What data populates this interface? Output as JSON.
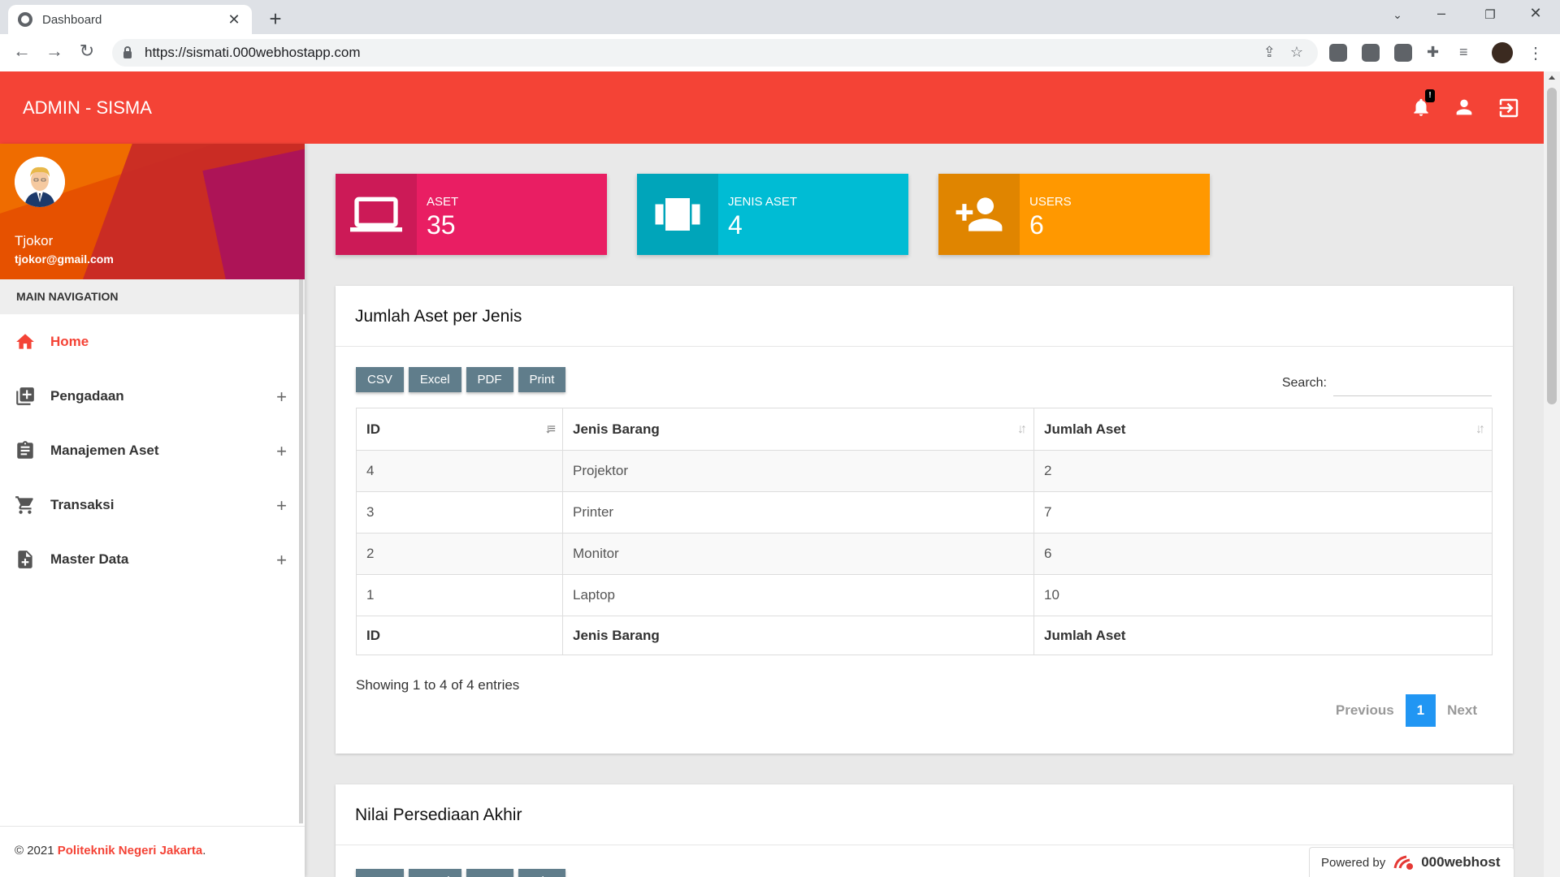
{
  "browser": {
    "tab_title": "Dashboard",
    "url": "https://sismati.000webhostapp.com"
  },
  "header": {
    "brand": "ADMIN - SISMA",
    "notification_count": "!"
  },
  "sidebar": {
    "user_name": "Tjokor",
    "user_email": "tjokor@gmail.com",
    "menu_header": "MAIN NAVIGATION",
    "items": [
      {
        "label": "Home",
        "icon": "home-icon",
        "active": true
      },
      {
        "label": "Pengadaan",
        "icon": "library-add-icon"
      },
      {
        "label": "Manajemen Aset",
        "icon": "assignment-icon"
      },
      {
        "label": "Transaksi",
        "icon": "cart-icon"
      },
      {
        "label": "Master Data",
        "icon": "note-add-icon"
      }
    ],
    "footer_prefix": "© 2021 ",
    "footer_org": "Politeknik Negeri Jakarta",
    "footer_suffix": "."
  },
  "info_boxes": [
    {
      "label": "ASET",
      "value": "35",
      "color": "#e91e63",
      "icon": "laptop-icon"
    },
    {
      "label": "JENIS ASET",
      "value": "4",
      "color": "#00bcd4",
      "icon": "view-array-icon"
    },
    {
      "label": "USERS",
      "value": "6",
      "color": "#ff9800",
      "icon": "person-add-icon"
    }
  ],
  "card1": {
    "title": "Jumlah Aset per Jenis",
    "buttons": [
      "CSV",
      "Excel",
      "PDF",
      "Print"
    ],
    "search_label": "Search:",
    "columns": [
      "ID",
      "Jenis Barang",
      "Jumlah Aset"
    ],
    "rows": [
      [
        "4",
        "Projektor",
        "2"
      ],
      [
        "3",
        "Printer",
        "7"
      ],
      [
        "2",
        "Monitor",
        "6"
      ],
      [
        "1",
        "Laptop",
        "10"
      ]
    ],
    "info": "Showing 1 to 4 of 4 entries",
    "pager": {
      "previous": "Previous",
      "current": "1",
      "next": "Next"
    }
  },
  "card2": {
    "title": "Nilai Persediaan Akhir",
    "buttons": [
      "CSV",
      "Excel",
      "PDF",
      "Print"
    ]
  },
  "watermark": {
    "prefix": "Powered by",
    "brand": "000webhost"
  }
}
